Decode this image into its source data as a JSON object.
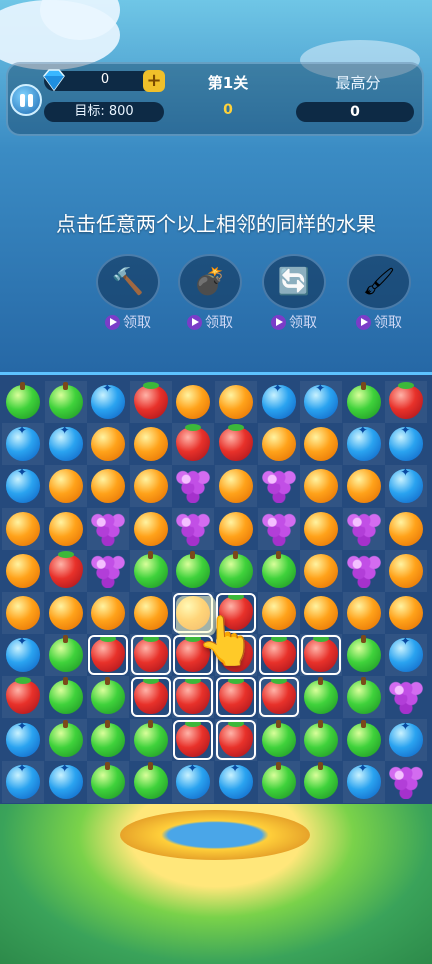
{
  "hud": {
    "gems": "0",
    "plus_label": "+",
    "target_label": "目标: 800",
    "level_title": "第1关",
    "level_score": "0",
    "best_title": "最高分",
    "best_score": "0"
  },
  "tip": "点击任意两个以上相邻的同样的水果",
  "tools": [
    {
      "icon": "hammer-icon",
      "glyph": "🔨",
      "label": "领取"
    },
    {
      "icon": "bomb-icon",
      "glyph": "💣",
      "label": "领取"
    },
    {
      "icon": "refresh-icon",
      "glyph": "🔄",
      "label": "领取"
    },
    {
      "icon": "paintbrush-icon",
      "glyph": "🖌",
      "label": "领取"
    }
  ],
  "board": {
    "rows": [
      [
        "apple",
        "apple",
        "blue",
        "straw",
        "orange",
        "orange",
        "blue",
        "blue",
        "apple",
        "straw"
      ],
      [
        "blue",
        "blue",
        "orange",
        "orange",
        "straw",
        "straw",
        "orange",
        "orange",
        "blue",
        "blue"
      ],
      [
        "blue",
        "orange",
        "orange",
        "orange",
        "grape",
        "orange",
        "grape",
        "orange",
        "orange",
        "blue"
      ],
      [
        "orange",
        "orange",
        "grape",
        "orange",
        "grape",
        "orange",
        "grape",
        "orange",
        "grape",
        "orange"
      ],
      [
        "orange",
        "straw",
        "grape",
        "apple",
        "apple",
        "apple",
        "apple",
        "orange",
        "grape",
        "orange"
      ],
      [
        "orange",
        "orange",
        "orange",
        "orange",
        "orange",
        "straw",
        "orange",
        "orange",
        "orange",
        "orange"
      ],
      [
        "blue",
        "apple",
        "straw",
        "straw",
        "straw",
        "straw",
        "straw",
        "straw",
        "apple",
        "blue"
      ],
      [
        "straw",
        "apple",
        "apple",
        "straw",
        "straw",
        "straw",
        "straw",
        "apple",
        "apple",
        "grape"
      ],
      [
        "blue",
        "apple",
        "apple",
        "apple",
        "straw",
        "straw",
        "apple",
        "apple",
        "apple",
        "blue"
      ],
      [
        "blue",
        "blue",
        "apple",
        "apple",
        "blue",
        "blue",
        "apple",
        "apple",
        "blue",
        "grape"
      ]
    ],
    "selected": [
      [
        5,
        4
      ],
      [
        5,
        5
      ],
      [
        6,
        2
      ],
      [
        6,
        3
      ],
      [
        6,
        4
      ],
      [
        6,
        5
      ],
      [
        6,
        6
      ],
      [
        6,
        7
      ],
      [
        7,
        3
      ],
      [
        7,
        4
      ],
      [
        7,
        5
      ],
      [
        7,
        6
      ],
      [
        8,
        4
      ],
      [
        8,
        5
      ]
    ]
  }
}
